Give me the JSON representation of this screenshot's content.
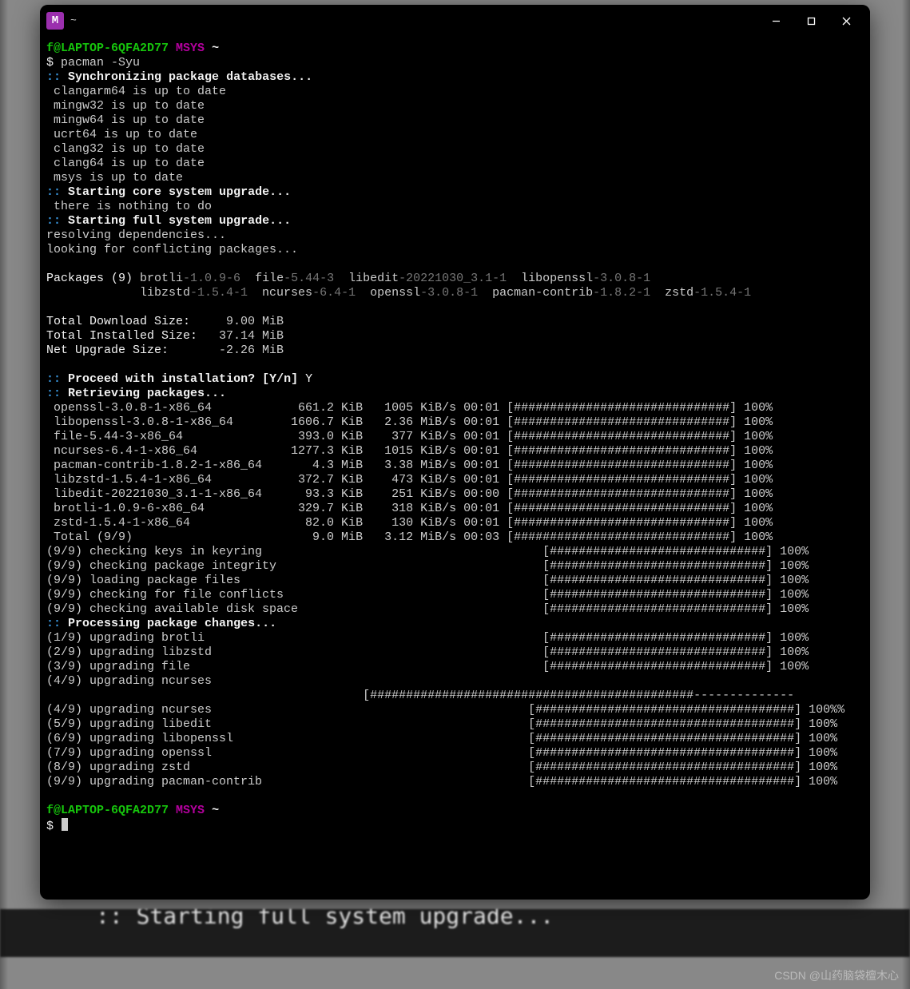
{
  "window": {
    "icon_letter": "M",
    "title": "~",
    "minimize_glyph": "—",
    "maximize_glyph": "▢",
    "close_glyph": "✕"
  },
  "prompt": {
    "user_host": "f@LAPTOP-6QFA2D77",
    "env": "MSYS",
    "path": "~",
    "symbol": "$"
  },
  "command": "pacman -Syu",
  "sync_header": ":: Synchronizing package databases...",
  "db_status": [
    "clangarm64 is up to date",
    "mingw32 is up to date",
    "mingw64 is up to date",
    "ucrt64 is up to date",
    "clang32 is up to date",
    "clang64 is up to date",
    "msys is up to date"
  ],
  "core_upgrade_header": ":: Starting core system upgrade...",
  "core_upgrade_msg": " there is nothing to do",
  "full_upgrade_header": ":: Starting full system upgrade...",
  "resolving": "resolving dependencies...",
  "looking": "looking for conflicting packages...",
  "packages_label": "Packages (9)",
  "packages": [
    {
      "name": "brotli",
      "ver": "-1.0.9-6"
    },
    {
      "name": "file",
      "ver": "-5.44-3"
    },
    {
      "name": "libedit",
      "ver": "-20221030_3.1-1"
    },
    {
      "name": "libopenssl",
      "ver": "-3.0.8-1"
    },
    {
      "name": "libzstd",
      "ver": "-1.5.4-1"
    },
    {
      "name": "ncurses",
      "ver": "-6.4-1"
    },
    {
      "name": "openssl",
      "ver": "-3.0.8-1"
    },
    {
      "name": "pacman-contrib",
      "ver": "-1.8.2-1"
    },
    {
      "name": "zstd",
      "ver": "-1.5.4-1"
    }
  ],
  "sizes": {
    "download_label": "Total Download Size:",
    "download_val": "   9.00 MiB",
    "installed_label": "Total Installed Size:",
    "installed_val": "  37.14 MiB",
    "net_label": "Net Upgrade Size:",
    "net_val": "  -2.26 MiB"
  },
  "proceed_prompt": ":: Proceed with installation? [Y/n] ",
  "proceed_answer": "Y",
  "retrieve_header": ":: Retrieving packages...",
  "bar": "[##############################]",
  "pct": "100%",
  "downloads": [
    {
      "name": " openssl-3.0.8-1-x86_64",
      "size": " 661.2 KiB",
      "rate": " 1005 KiB/s",
      "time": "00:01"
    },
    {
      "name": " libopenssl-3.0.8-1-x86_64",
      "size": "1606.7 KiB",
      "rate": " 2.36 MiB/s",
      "time": "00:01"
    },
    {
      "name": " file-5.44-3-x86_64",
      "size": " 393.0 KiB",
      "rate": "  377 KiB/s",
      "time": "00:01"
    },
    {
      "name": " ncurses-6.4-1-x86_64",
      "size": "1277.3 KiB",
      "rate": " 1015 KiB/s",
      "time": "00:01"
    },
    {
      "name": " pacman-contrib-1.8.2-1-x86_64",
      "size": "   4.3 MiB",
      "rate": " 3.38 MiB/s",
      "time": "00:01"
    },
    {
      "name": " libzstd-1.5.4-1-x86_64",
      "size": " 372.7 KiB",
      "rate": "  473 KiB/s",
      "time": "00:01"
    },
    {
      "name": " libedit-20221030_3.1-1-x86_64",
      "size": "  93.3 KiB",
      "rate": "  251 KiB/s",
      "time": "00:00"
    },
    {
      "name": " brotli-1.0.9-6-x86_64",
      "size": " 329.7 KiB",
      "rate": "  318 KiB/s",
      "time": "00:01"
    },
    {
      "name": " zstd-1.5.4-1-x86_64",
      "size": "  82.0 KiB",
      "rate": "  130 KiB/s",
      "time": "00:01"
    },
    {
      "name": " Total (9/9)",
      "size": "   9.0 MiB",
      "rate": " 3.12 MiB/s",
      "time": "00:03"
    }
  ],
  "checks": [
    "(9/9) checking keys in keyring",
    "(9/9) checking package integrity",
    "(9/9) loading package files",
    "(9/9) checking for file conflicts",
    "(9/9) checking available disk space"
  ],
  "processing_header": ":: Processing package changes...",
  "upgrades_short": [
    "(1/9) upgrading brotli",
    "(2/9) upgrading libzstd",
    "(3/9) upgrading file"
  ],
  "upgrade_ncurses_line": "(4/9) upgrading ncurses",
  "partial_bar": "[#############################################--------------",
  "upgrades_long": [
    {
      "txt": "(4/9) upgrading ncurses",
      "pct": "100%%"
    },
    {
      "txt": "(5/9) upgrading libedit",
      "pct": "100%"
    },
    {
      "txt": "(6/9) upgrading libopenssl",
      "pct": "100%"
    },
    {
      "txt": "(7/9) upgrading openssl",
      "pct": "100%"
    },
    {
      "txt": "(8/9) upgrading zstd",
      "pct": "100%"
    },
    {
      "txt": "(9/9) upgrading pacman-contrib",
      "pct": "100%"
    }
  ],
  "bar2": "[####################################]",
  "watermark": "CSDN @山药脑袋檀木心",
  "bottom_blur": ":: Starting full system upgrade..."
}
